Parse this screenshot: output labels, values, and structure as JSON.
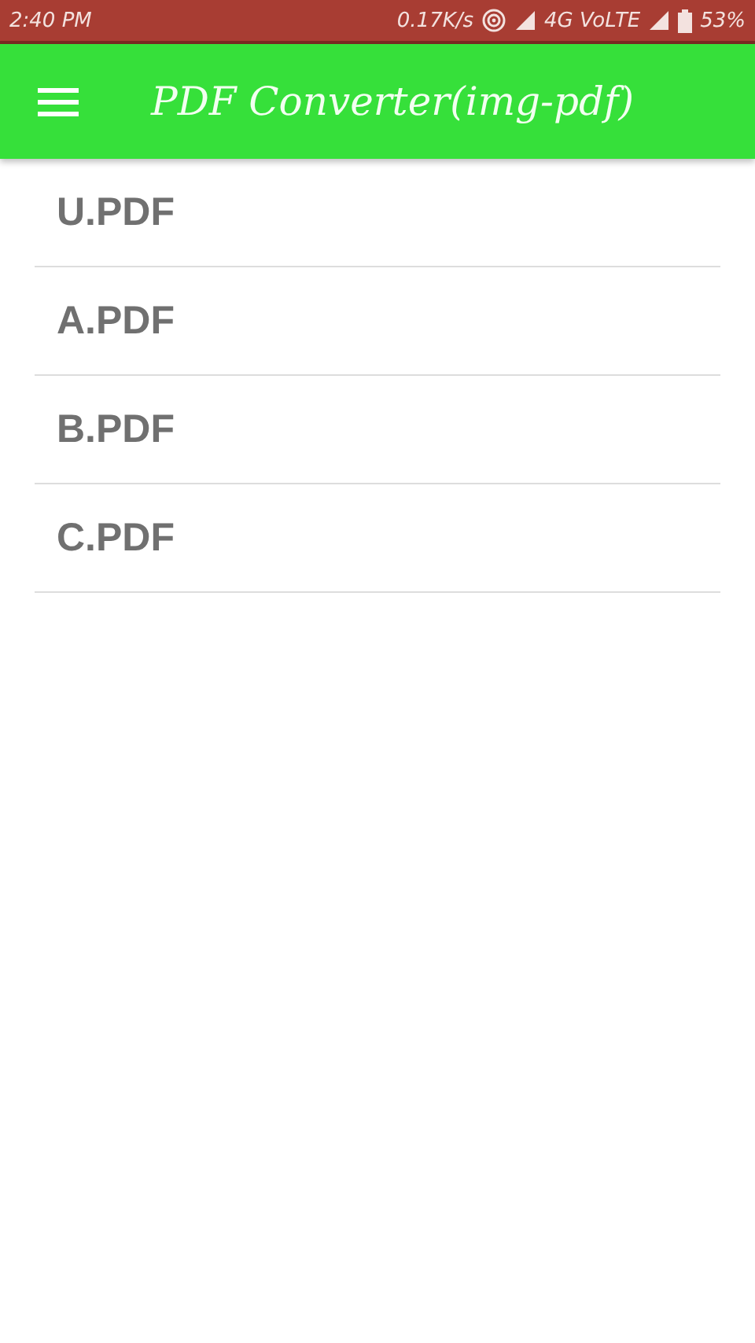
{
  "status_bar": {
    "time": "2:40 PM",
    "speed": "0.17K/s",
    "network": "4G VoLTE",
    "battery": "53%"
  },
  "app_bar": {
    "title": "PDF Converter(img-pdf)"
  },
  "files": [
    {
      "name": "U.PDF"
    },
    {
      "name": "A.PDF"
    },
    {
      "name": "B.PDF"
    },
    {
      "name": "C.PDF"
    }
  ]
}
